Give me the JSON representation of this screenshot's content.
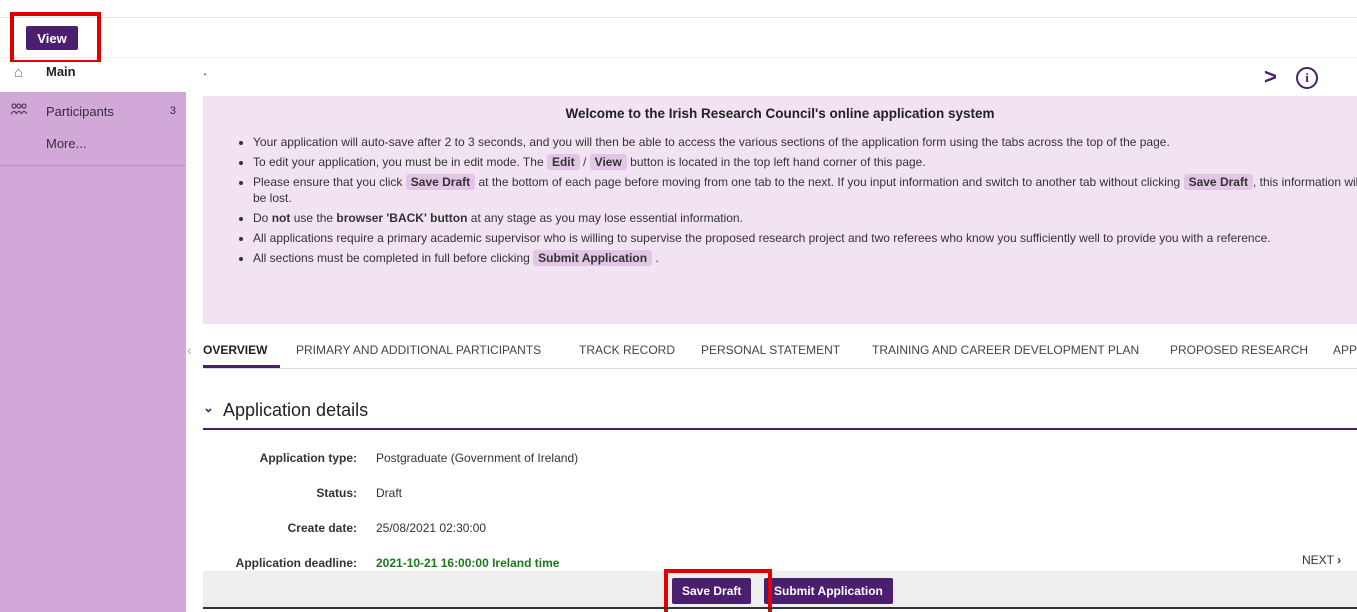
{
  "toolbar": {
    "view_label": "View"
  },
  "sidebar": {
    "main_label": "Main",
    "items": [
      {
        "label": "Participants",
        "count": "3",
        "icon": "participants-icon"
      },
      {
        "label": "More...",
        "count": "",
        "icon": ""
      }
    ]
  },
  "header": {
    "dot": "."
  },
  "welcome": {
    "title": "Welcome to the Irish Research Council's online application system",
    "b1": "Your application will auto-save after 2 to 3 seconds, and you will then be able to access the various sections of the application form using the tabs across the top of the page.",
    "b2_pre": "To edit your application, you must be in edit mode. The",
    "b2_edit": "Edit",
    "b2_slash": "/",
    "b2_view": "View",
    "b2_post": "button is located in the top left hand corner of this page.",
    "b3_pre": "Please ensure that you click",
    "b3_save1": "Save Draft",
    "b3_mid": "at the bottom of each page before moving from one tab to the next. If you input information and switch to another tab without clicking",
    "b3_save2": "Save Draft",
    "b3_post": ", this information will be lost.",
    "b4_pre": "Do",
    "b4_not": "not",
    "b4_mid": "use the",
    "b4_back": "browser 'BACK' button",
    "b4_post": "at any stage as you may lose essential information.",
    "b5": "All applications require a primary academic supervisor who is willing to supervise the proposed research project and two referees who know you sufficiently well to provide you with a reference.",
    "b6_pre": "All sections must be completed in full before clicking",
    "b6_submit": "Submit Application",
    "b6_post": "."
  },
  "tabs": [
    "OVERVIEW",
    "PRIMARY AND ADDITIONAL PARTICIPANTS",
    "TRACK RECORD",
    "PERSONAL STATEMENT",
    "TRAINING AND CAREER DEVELOPMENT PLAN",
    "PROPOSED RESEARCH",
    "APP"
  ],
  "section": {
    "title": "Application details"
  },
  "fields": [
    {
      "label": "Application type:",
      "value": "Postgraduate (Government of Ireland)"
    },
    {
      "label": "Status:",
      "value": "Draft"
    },
    {
      "label": "Create date:",
      "value": "25/08/2021 02:30:00"
    },
    {
      "label": "Application deadline:",
      "value": "2021-10-21 16:00:00 Ireland time"
    }
  ],
  "nav": {
    "next": "NEXT"
  },
  "footer": {
    "save_draft": "Save Draft",
    "submit": "Submit Application"
  },
  "colors": {
    "accent": "#4b1f6f",
    "sidebar": "#d2a8d8",
    "panel": "#f2e3f3",
    "highlight": "#e00000",
    "deadline": "#1a7a1a"
  }
}
